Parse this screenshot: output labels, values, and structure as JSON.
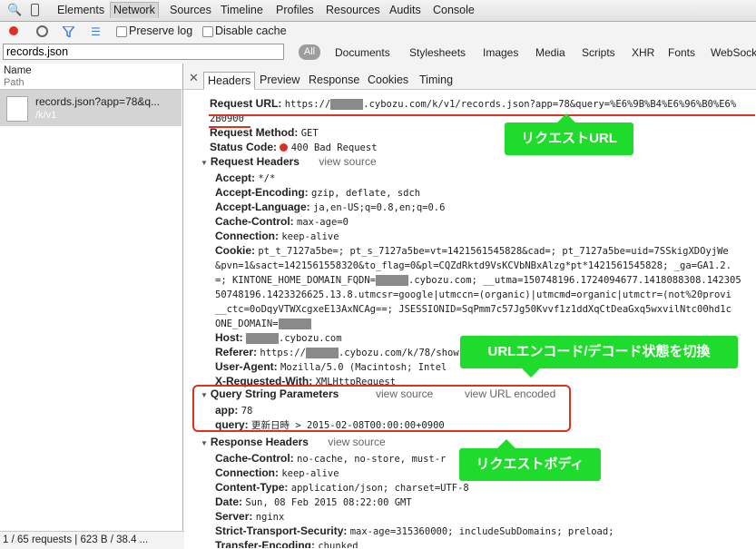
{
  "top_tabs": [
    "Elements",
    "Network",
    "Sources",
    "Timeline",
    "Profiles",
    "Resources",
    "Audits",
    "Console"
  ],
  "toolbar": {
    "preserve_log": "Preserve log",
    "disable_cache": "Disable cache"
  },
  "filter": {
    "value": "records.json",
    "all": "All",
    "types": [
      "Documents",
      "Stylesheets",
      "Images",
      "Media",
      "Scripts",
      "XHR",
      "Fonts",
      "WebSock"
    ]
  },
  "left": {
    "col_name": "Name",
    "col_path": "Path",
    "request_name": "records.json?app=78&q...",
    "request_path": "/k/v1",
    "status": "1 / 65 requests | 623 B / 38.4 ..."
  },
  "detail_tabs": [
    "Headers",
    "Preview",
    "Response",
    "Cookies",
    "Timing"
  ],
  "general": {
    "request_url_label": "Request URL:",
    "request_url_1": "https://",
    "request_url_2": ".cybozu.com/k/v1/records.json?app=78&query=%E6%9B%B4%E6%96%B0%E6%",
    "request_url_3": "2B0900",
    "method_label": "Request Method:",
    "method": "GET",
    "status_label": "Status Code:",
    "status": "400 Bad Request"
  },
  "request_headers": {
    "title": "Request Headers",
    "view_source": "view source",
    "accept": [
      "Accept:",
      "*/*"
    ],
    "accept_encoding": [
      "Accept-Encoding:",
      "gzip, deflate, sdch"
    ],
    "accept_language": [
      "Accept-Language:",
      "ja,en-US;q=0.8,en;q=0.6"
    ],
    "cache_control": [
      "Cache-Control:",
      "max-age=0"
    ],
    "connection": [
      "Connection:",
      "keep-alive"
    ],
    "cookie_label": "Cookie:",
    "cookie_1": "pt_t_7127a5be=; pt_s_7127a5be=vt=1421561545828&cad=; pt_7127a5be=uid=7SSkigXDOyjWe",
    "cookie_2": "&pvn=1&sact=1421561558320&to_flag=0&pl=CQZdRktd9VsKCVbNBxAlzg*pt*1421561545828; _ga=GA1.2.",
    "cookie_3a": "=; KINTONE_HOME_DOMAIN_FQDN=",
    "cookie_3b": ".cybozu.com; __utma=150748196.1724094677.1418088308.142305",
    "cookie_4": "50748196.1423326625.13.8.utmcsr=google|utmccn=(organic)|utmcmd=organic|utmctr=(not%20provi",
    "cookie_5": "__ctc=0oDqyVTWXcgxeE13AxNCAg==; JSESSIONID=SqPmm7c57Jg50Kvvf1z1ddXqCtDeaGxq5wxvilNtc00hd1c",
    "cookie_6": "ONE_DOMAIN=",
    "host_label": "Host:",
    "host": ".cybozu.com",
    "referer_label": "Referer:",
    "referer_1": "https://",
    "referer_2": ".cybozu.com/k/78/show",
    "ua_label": "User-Agent:",
    "ua": "Mozilla/5.0 (Macintosh; Intel",
    "xrw": [
      "X-Requested-With:",
      "XMLHttpRequest"
    ]
  },
  "query": {
    "title": "Query String Parameters",
    "view_source": "view source",
    "view_url_encoded": "view URL encoded",
    "app": [
      "app:",
      "78"
    ],
    "query": [
      "query:",
      "更新日時 > 2015-02-08T00:00:00+0900"
    ]
  },
  "response_headers": {
    "title": "Response Headers",
    "view_source": "view source",
    "cache_control": [
      "Cache-Control:",
      "no-cache, no-store, must-r"
    ],
    "connection": [
      "Connection:",
      "keep-alive"
    ],
    "content_type": [
      "Content-Type:",
      "application/json; charset=UTF-8"
    ],
    "date": [
      "Date:",
      "Sun, 08 Feb 2015 08:22:00 GMT"
    ],
    "server": [
      "Server:",
      "nginx"
    ],
    "sts": [
      "Strict-Transport-Security:",
      "max-age=315360000; includeSubDomains; preload;"
    ],
    "te": [
      "Transfer-Encoding:",
      "chunked"
    ]
  },
  "callouts": {
    "request_url": "リクエストURL",
    "toggle": "URLエンコード/デコード状態を切換",
    "body": "リクエストボディ"
  },
  "colors": {
    "annotation_red": "#e0301e",
    "callout_green": "#1fdc2c",
    "status_red": "#d93025"
  }
}
